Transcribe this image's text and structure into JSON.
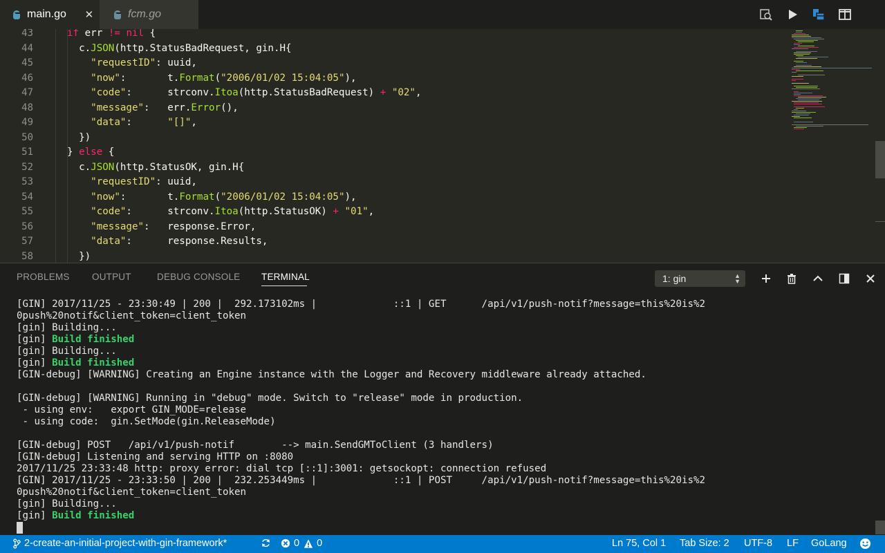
{
  "tabs": [
    {
      "label": "main.go",
      "active": true,
      "close": "✕"
    },
    {
      "label": "fcm.go",
      "active": false
    }
  ],
  "toolbar_icons": [
    "open-preview-search-icon",
    "run-icon",
    "split-vertical-icon",
    "split-editor-icon"
  ],
  "editor": {
    "line_numbers": [
      "43",
      "44",
      "45",
      "46",
      "47",
      "48",
      "49",
      "50",
      "51",
      "52",
      "53",
      "54",
      "55",
      "56",
      "57",
      "58"
    ],
    "code": [
      [
        {
          "t": "if",
          "c": "kw"
        },
        {
          "t": " err ",
          "c": "plain"
        },
        {
          "t": "!=",
          "c": "kw"
        },
        {
          "t": " ",
          "c": "plain"
        },
        {
          "t": "nil",
          "c": "kw"
        },
        {
          "t": " {",
          "c": "plain"
        }
      ],
      [
        {
          "t": "  c.",
          "c": "plain"
        },
        {
          "t": "JSON",
          "c": "fn"
        },
        {
          "t": "(http.StatusBadRequest, gin.H{",
          "c": "plain"
        }
      ],
      [
        {
          "t": "    ",
          "c": "plain"
        },
        {
          "t": "\"requestID\"",
          "c": "str"
        },
        {
          "t": ": uuid,",
          "c": "plain"
        }
      ],
      [
        {
          "t": "    ",
          "c": "plain"
        },
        {
          "t": "\"now\"",
          "c": "str"
        },
        {
          "t": ":       t.",
          "c": "plain"
        },
        {
          "t": "Format",
          "c": "fn"
        },
        {
          "t": "(",
          "c": "plain"
        },
        {
          "t": "\"2006/01/02 15:04:05\"",
          "c": "str"
        },
        {
          "t": "),",
          "c": "plain"
        }
      ],
      [
        {
          "t": "    ",
          "c": "plain"
        },
        {
          "t": "\"code\"",
          "c": "str"
        },
        {
          "t": ":      strconv.",
          "c": "plain"
        },
        {
          "t": "Itoa",
          "c": "fn"
        },
        {
          "t": "(http.StatusBadRequest) ",
          "c": "plain"
        },
        {
          "t": "+",
          "c": "kw"
        },
        {
          "t": " ",
          "c": "plain"
        },
        {
          "t": "\"02\"",
          "c": "str"
        },
        {
          "t": ",",
          "c": "plain"
        }
      ],
      [
        {
          "t": "    ",
          "c": "plain"
        },
        {
          "t": "\"message\"",
          "c": "str"
        },
        {
          "t": ":   err.",
          "c": "plain"
        },
        {
          "t": "Error",
          "c": "fn"
        },
        {
          "t": "(),",
          "c": "plain"
        }
      ],
      [
        {
          "t": "    ",
          "c": "plain"
        },
        {
          "t": "\"data\"",
          "c": "str"
        },
        {
          "t": ":      ",
          "c": "plain"
        },
        {
          "t": "\"[]\"",
          "c": "str"
        },
        {
          "t": ",",
          "c": "plain"
        }
      ],
      [
        {
          "t": "  })",
          "c": "plain"
        }
      ],
      [
        {
          "t": "} ",
          "c": "plain"
        },
        {
          "t": "else",
          "c": "kw"
        },
        {
          "t": " {",
          "c": "plain"
        }
      ],
      [
        {
          "t": "  c.",
          "c": "plain"
        },
        {
          "t": "JSON",
          "c": "fn"
        },
        {
          "t": "(http.StatusOK, gin.H{",
          "c": "plain"
        }
      ],
      [
        {
          "t": "    ",
          "c": "plain"
        },
        {
          "t": "\"requestID\"",
          "c": "str"
        },
        {
          "t": ": uuid,",
          "c": "plain"
        }
      ],
      [
        {
          "t": "    ",
          "c": "plain"
        },
        {
          "t": "\"now\"",
          "c": "str"
        },
        {
          "t": ":       t.",
          "c": "plain"
        },
        {
          "t": "Format",
          "c": "fn"
        },
        {
          "t": "(",
          "c": "plain"
        },
        {
          "t": "\"2006/01/02 15:04:05\"",
          "c": "str"
        },
        {
          "t": "),",
          "c": "plain"
        }
      ],
      [
        {
          "t": "    ",
          "c": "plain"
        },
        {
          "t": "\"code\"",
          "c": "str"
        },
        {
          "t": ":      strconv.",
          "c": "plain"
        },
        {
          "t": "Itoa",
          "c": "fn"
        },
        {
          "t": "(http.StatusOK) ",
          "c": "plain"
        },
        {
          "t": "+",
          "c": "kw"
        },
        {
          "t": " ",
          "c": "plain"
        },
        {
          "t": "\"01\"",
          "c": "str"
        },
        {
          "t": ",",
          "c": "plain"
        }
      ],
      [
        {
          "t": "    ",
          "c": "plain"
        },
        {
          "t": "\"message\"",
          "c": "str"
        },
        {
          "t": ":   response.Error,",
          "c": "plain"
        }
      ],
      [
        {
          "t": "    ",
          "c": "plain"
        },
        {
          "t": "\"data\"",
          "c": "str"
        },
        {
          "t": ":      response.Results,",
          "c": "plain"
        }
      ],
      [
        {
          "t": "  })",
          "c": "plain"
        }
      ]
    ]
  },
  "panel": {
    "tabs": [
      "PROBLEMS",
      "OUTPUT",
      "DEBUG CONSOLE",
      "TERMINAL"
    ],
    "active_tab": "TERMINAL",
    "terminal_select": "1: gin",
    "action_icons": [
      "add-icon",
      "trash-icon",
      "chevron-up-icon",
      "toggle-panel-icon",
      "close-icon"
    ]
  },
  "terminal": [
    [
      {
        "t": "[GIN] 2017/11/25 - 23:30:49 | 200 |  292.173102ms |             ::1 | GET      /api/v1/push-notif?message=this%20is%2",
        "c": ""
      }
    ],
    [
      {
        "t": "0push%20notif&client_token=client_token",
        "c": ""
      }
    ],
    [
      {
        "t": "[gin] Building...",
        "c": ""
      }
    ],
    [
      {
        "t": "[gin] ",
        "c": ""
      },
      {
        "t": "Build finished",
        "c": "green"
      }
    ],
    [
      {
        "t": "[gin] Building...",
        "c": ""
      }
    ],
    [
      {
        "t": "[gin] ",
        "c": ""
      },
      {
        "t": "Build finished",
        "c": "green"
      }
    ],
    [
      {
        "t": "[GIN-debug] [WARNING] Creating an Engine instance with the Logger and Recovery middleware already attached.",
        "c": ""
      }
    ],
    [
      {
        "t": "",
        "c": ""
      }
    ],
    [
      {
        "t": "[GIN-debug] [WARNING] Running in \"debug\" mode. Switch to \"release\" mode in production.",
        "c": ""
      }
    ],
    [
      {
        "t": " - using env:   export GIN_MODE=release",
        "c": ""
      }
    ],
    [
      {
        "t": " - using code:  gin.SetMode(gin.ReleaseMode)",
        "c": ""
      }
    ],
    [
      {
        "t": "",
        "c": ""
      }
    ],
    [
      {
        "t": "[GIN-debug] POST   /api/v1/push-notif        --> main.SendGMToClient (3 handlers)",
        "c": ""
      }
    ],
    [
      {
        "t": "[GIN-debug] Listening and serving HTTP on :8080",
        "c": ""
      }
    ],
    [
      {
        "t": "2017/11/25 23:33:48 http: proxy error: dial tcp [::1]:3001: getsockopt: connection refused",
        "c": ""
      }
    ],
    [
      {
        "t": "[GIN] 2017/11/25 - 23:33:50 | 200 |  232.253449ms |             ::1 | POST     /api/v1/push-notif?message=this%20is%2",
        "c": ""
      }
    ],
    [
      {
        "t": "0push%20notif&client_token=client_token",
        "c": ""
      }
    ],
    [
      {
        "t": "[gin] Building...",
        "c": ""
      }
    ],
    [
      {
        "t": "[gin] ",
        "c": ""
      },
      {
        "t": "Build finished",
        "c": "green"
      }
    ]
  ],
  "statusbar": {
    "branch": "2-create-an-initial-project-with-gin-framework*",
    "errors": "0",
    "warnings": "0",
    "position": "Ln 75, Col 1",
    "tab_size": "Tab Size: 2",
    "encoding": "UTF-8",
    "eol": "LF",
    "language": "GoLang",
    "background": "#007acc"
  },
  "colors": {
    "keyword": "#f92672",
    "function": "#a6e22e",
    "string": "#e6db74",
    "build_finished": "#3ad06a"
  }
}
